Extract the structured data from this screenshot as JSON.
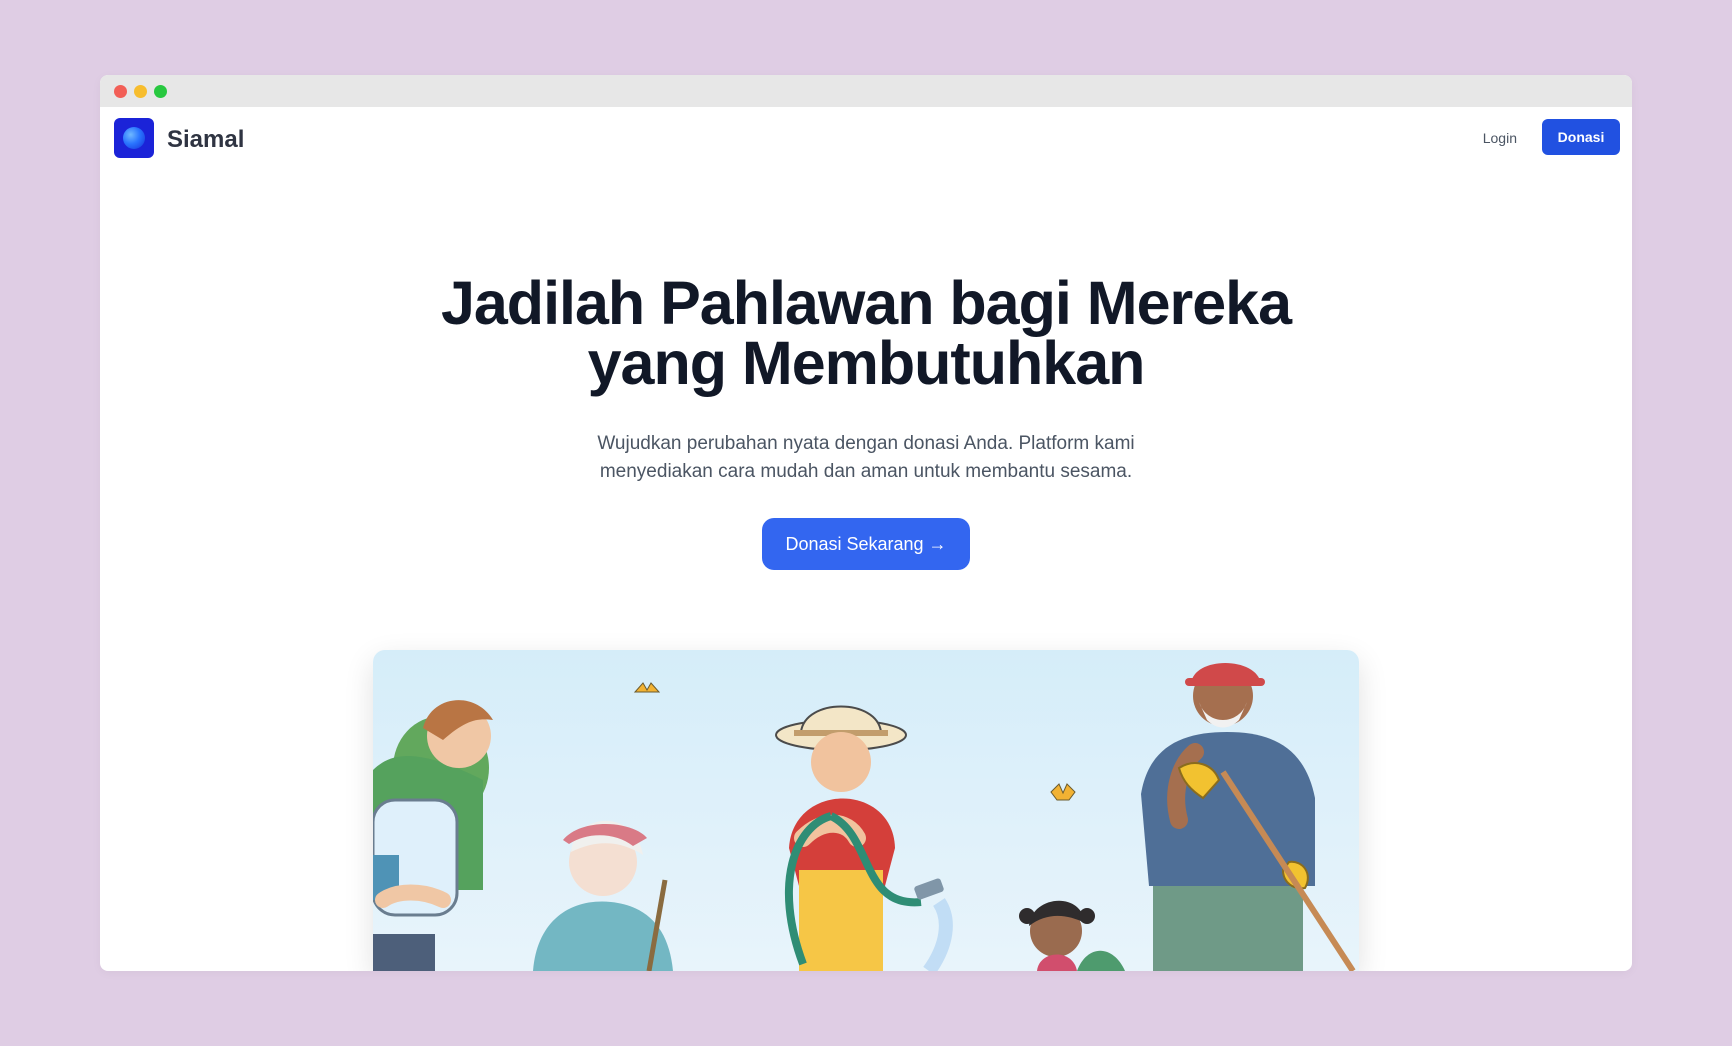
{
  "brand": {
    "name": "Siamal"
  },
  "nav": {
    "login_label": "Login",
    "donate_label": "Donasi"
  },
  "hero": {
    "title_line1": "Jadilah Pahlawan bagi Mereka",
    "title_line2": "yang Membutuhkan",
    "subtitle_line1": "Wujudkan perubahan nyata dengan donasi Anda. Platform kami",
    "subtitle_line2": "menyediakan cara mudah dan aman untuk membantu sesama.",
    "cta_label": "Donasi Sekarang →"
  },
  "colors": {
    "page_background": "#dfcde4",
    "window_background": "#ffffff",
    "titlebar_background": "#e7e7e7",
    "primary": "#2151e1",
    "cta": "#3366f0",
    "heading": "#111827",
    "muted": "#4b5563"
  },
  "icons": {
    "logo": "blue-orb-logo",
    "cta_arrow": "arrow-right"
  }
}
